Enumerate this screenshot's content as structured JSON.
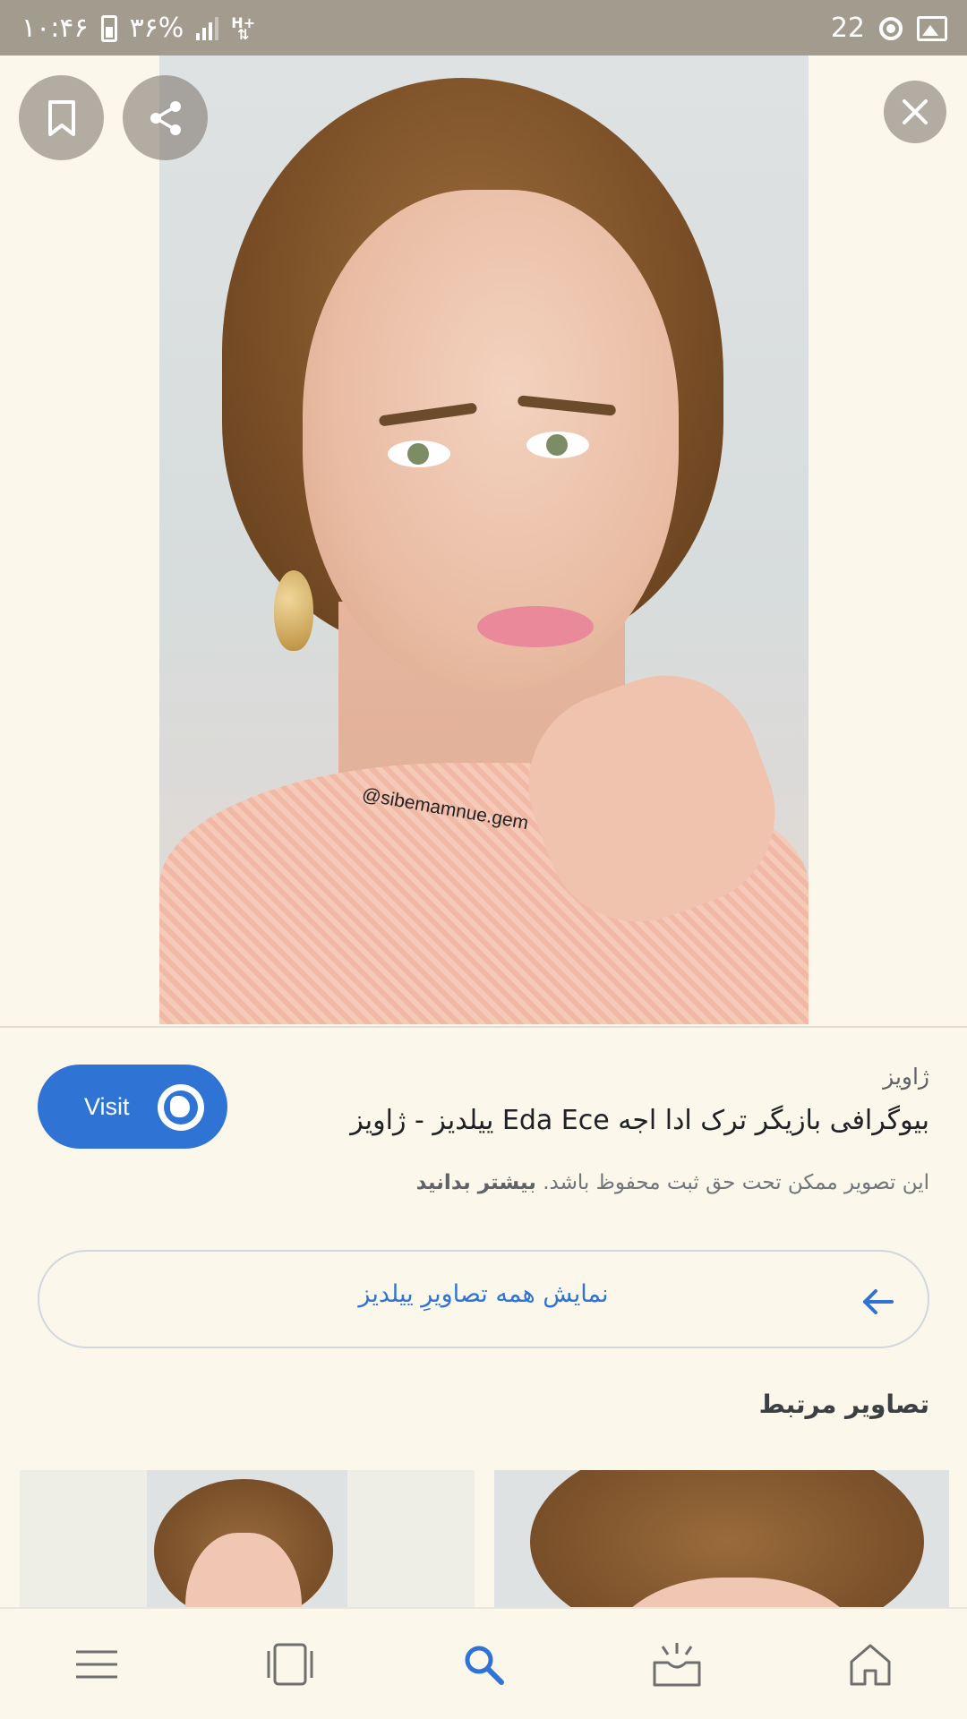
{
  "status_bar": {
    "time": "۱۰:۴۶",
    "battery": "۳۶%",
    "network": "H+",
    "notification_count": "22"
  },
  "viewer": {
    "watermark": "@sibemamnue.gem",
    "bookmark_icon": "bookmark-icon",
    "share_icon": "share-icon",
    "close_icon": "close-icon"
  },
  "result": {
    "visit_label": "Visit",
    "source": "ژاویز",
    "title": "بیوگرافی بازیگر ترک ادا اجه Eda Ece ییلدیز - ژاویز",
    "copyright_text": "این تصویر ممکن تحت حق ثبت محفوظ باشد.",
    "learn_more": "بیشتر بدانید",
    "all_images_label": "نمایش همه تصاویرِ ییلدیز"
  },
  "related": {
    "section_title": "تصاویر مرتبط"
  },
  "bottom_nav": {
    "items": [
      "menu-icon",
      "tabs-icon",
      "search-icon",
      "inbox-icon",
      "home-icon"
    ],
    "active": "search-icon"
  },
  "colors": {
    "accent": "#2f74d4",
    "background": "#fbf7ea",
    "status_bar": "#a39c8e"
  }
}
